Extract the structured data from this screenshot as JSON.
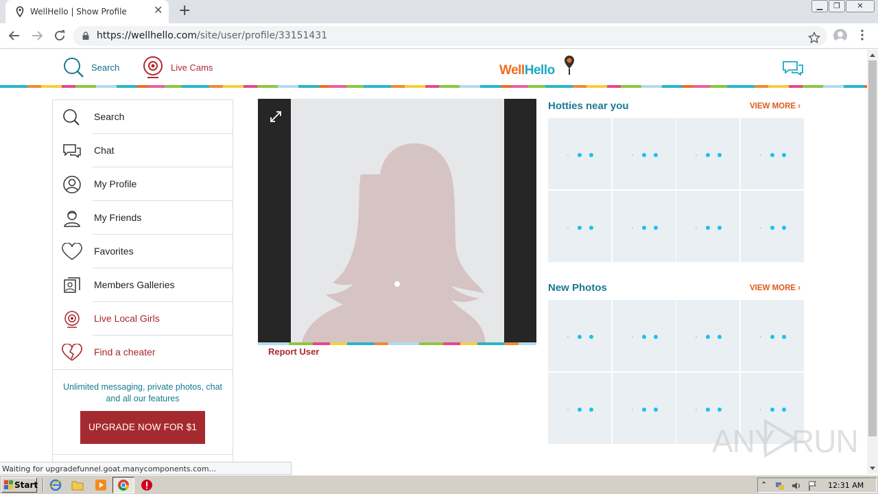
{
  "browser": {
    "tab_title": "WellHello | Show Profile",
    "new_tab": "+",
    "tab_close": "✕",
    "url_host": "https://wellhello.com",
    "url_path": "/site/user/profile/33151431"
  },
  "header": {
    "search_label": "Search",
    "cams_label": "Live Cams",
    "logo_part1": "Well",
    "logo_part2": "Hello"
  },
  "sidebar": {
    "items": [
      {
        "label": "Search",
        "icon": "search-icon"
      },
      {
        "label": "Chat",
        "icon": "chat-icon"
      },
      {
        "label": "My Profile",
        "icon": "profile-icon"
      },
      {
        "label": "My Friends",
        "icon": "friends-icon"
      },
      {
        "label": "Favorites",
        "icon": "heart-icon"
      },
      {
        "label": "Members Galleries",
        "icon": "gallery-icon"
      },
      {
        "label": "Live Local Girls",
        "icon": "webcam-icon"
      },
      {
        "label": "Find a cheater",
        "icon": "broken-heart-icon"
      }
    ],
    "upgrade_text": "Unlimited messaging, private photos, chat and all our features",
    "upgrade_button": "UPGRADE NOW FOR $1"
  },
  "profile": {
    "report_label": "Report User"
  },
  "hotties": {
    "title": "Hotties near you",
    "view_more": "VIEW MORE ›"
  },
  "new_photos": {
    "title": "New Photos",
    "view_more": "VIEW MORE ›"
  },
  "status": {
    "text": "Waiting for upgradefunnel.goat.manycomponents.com..."
  },
  "watermark": {
    "left": "ANY",
    "right": "RUN"
  },
  "taskbar": {
    "start_label": "Start",
    "clock": "12:31 AM"
  },
  "colors": {
    "brand_teal": "#177a92",
    "brand_red": "#a52a2f",
    "brand_orange": "#f26a21",
    "loading_dot": "#19c3e6"
  }
}
